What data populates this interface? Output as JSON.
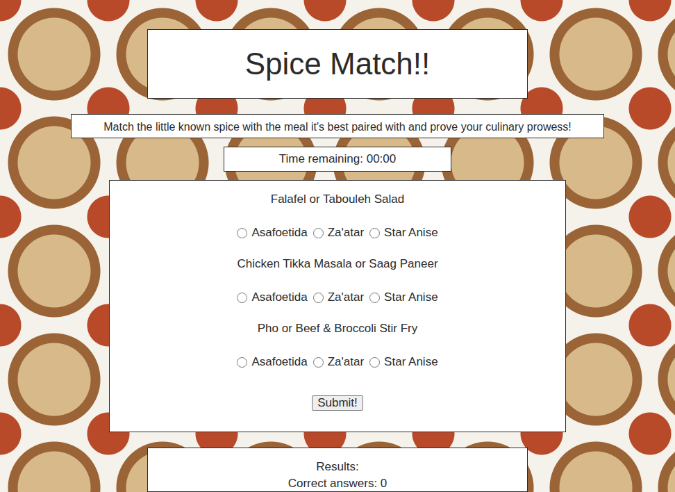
{
  "page": {
    "title": "Spice Match!!",
    "instructions": "Match the little known spice with the meal it's best paired with and prove your culinary prowess!",
    "timer": "Time remaining: 00:00"
  },
  "questions": [
    {
      "meal": "Falafel or Tabouleh Salad",
      "options": [
        {
          "label": "Asafoetida",
          "selected": false
        },
        {
          "label": "Za'atar",
          "selected": false
        },
        {
          "label": "Star Anise",
          "selected": false
        }
      ]
    },
    {
      "meal": "Chicken Tikka Masala or Saag Paneer",
      "options": [
        {
          "label": "Asafoetida",
          "selected": false
        },
        {
          "label": "Za'atar",
          "selected": false
        },
        {
          "label": "Star Anise",
          "selected": false
        }
      ]
    },
    {
      "meal": "Pho or Beef & Broccoli Stir Fry",
      "options": [
        {
          "label": "Asafoetida",
          "selected": false
        },
        {
          "label": "Za'atar",
          "selected": false
        },
        {
          "label": "Star Anise",
          "selected": false
        }
      ]
    }
  ],
  "submit": {
    "label": "Submit!"
  },
  "results": {
    "label": "Results:",
    "correct": "Correct answers: 0"
  }
}
